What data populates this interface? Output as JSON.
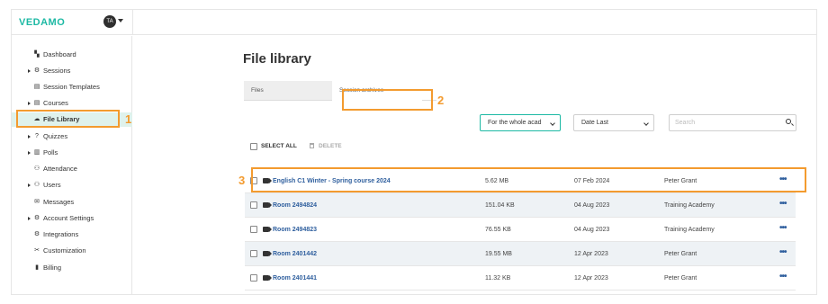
{
  "app": {
    "logo": "VEDAMO",
    "avatar_initials": "TA"
  },
  "sidebar": {
    "items": [
      {
        "label": "Dashboard",
        "icon": "dashboard-icon",
        "glyph": "▚",
        "expandable": false
      },
      {
        "label": "Sessions",
        "icon": "sessions-icon",
        "glyph": "⚙",
        "expandable": true
      },
      {
        "label": "Session Templates",
        "icon": "templates-icon",
        "glyph": "▤",
        "expandable": false
      },
      {
        "label": "Courses",
        "icon": "courses-icon",
        "glyph": "▤",
        "expandable": true
      },
      {
        "label": "File Library",
        "icon": "cloud-icon",
        "glyph": "☁",
        "expandable": false,
        "active": true
      },
      {
        "label": "Quizzes",
        "icon": "question-icon",
        "glyph": "?",
        "expandable": true
      },
      {
        "label": "Polls",
        "icon": "polls-icon",
        "glyph": "▥",
        "expandable": true
      },
      {
        "label": "Attendance",
        "icon": "attendance-icon",
        "glyph": "⚇",
        "expandable": false
      },
      {
        "label": "Users",
        "icon": "users-icon",
        "glyph": "⚇",
        "expandable": true
      },
      {
        "label": "Messages",
        "icon": "envelope-icon",
        "glyph": "✉",
        "expandable": false
      },
      {
        "label": "Account Settings",
        "icon": "gear-icon",
        "glyph": "⚙",
        "expandable": true
      },
      {
        "label": "Integrations",
        "icon": "integrations-icon",
        "glyph": "⚙",
        "expandable": false
      },
      {
        "label": "Customization",
        "icon": "customization-icon",
        "glyph": "✂",
        "expandable": false
      },
      {
        "label": "Billing",
        "icon": "billing-icon",
        "glyph": "▮",
        "expandable": false
      }
    ]
  },
  "main": {
    "title": "File library",
    "tabs": [
      {
        "label": "Files"
      },
      {
        "label": "Session archives"
      }
    ],
    "filters": {
      "period": "For the whole acad",
      "sort": "Date Last",
      "search_placeholder": "Search"
    },
    "bulk": {
      "select_all": "SELECT ALL",
      "delete": "DELETE"
    },
    "rows": [
      {
        "name": "English C1 Winter - Spring course 2024",
        "size": "5.62 MB",
        "date": "07 Feb 2024",
        "owner": "Peter Grant"
      },
      {
        "name": "Room 2494824",
        "size": "151.04 KB",
        "date": "04 Aug 2023",
        "owner": "Training Academy"
      },
      {
        "name": "Room 2494823",
        "size": "76.55 KB",
        "date": "04 Aug 2023",
        "owner": "Training Academy"
      },
      {
        "name": "Room 2401442",
        "size": "19.55 MB",
        "date": "12 Apr 2023",
        "owner": "Peter Grant"
      },
      {
        "name": "Room 2401441",
        "size": "11.32 KB",
        "date": "12 Apr 2023",
        "owner": "Peter Grant"
      }
    ],
    "more_glyph": "•••"
  },
  "callouts": {
    "one": "1",
    "two": "2",
    "three": "3"
  },
  "colors": {
    "brand": "#1db9a4",
    "accent_link": "#2f5f9e",
    "annotation": "#f39b2f"
  }
}
